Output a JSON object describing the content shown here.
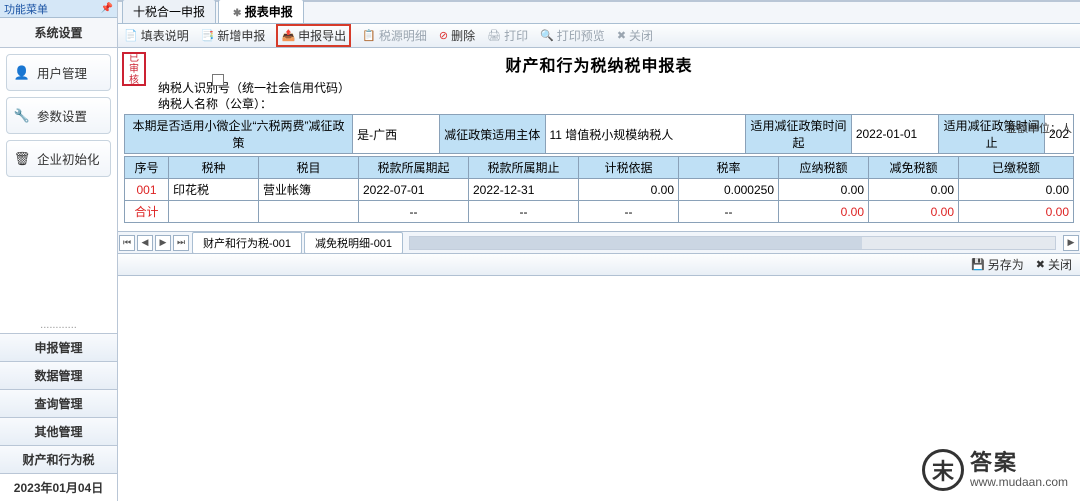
{
  "sidebar": {
    "title": "功能菜单",
    "group_label": "系统设置",
    "items": [
      {
        "label": "用户管理",
        "icon": "👤"
      },
      {
        "label": "参数设置",
        "icon": "🔧"
      },
      {
        "label": "企业初始化",
        "icon": "🗑"
      }
    ],
    "links": [
      "申报管理",
      "数据管理",
      "查询管理",
      "其他管理",
      "财产和行为税"
    ],
    "date": "2023年01月04日"
  },
  "tabs": [
    {
      "label": "十税合一申报"
    },
    {
      "label": "报表申报"
    }
  ],
  "toolbar": {
    "items": [
      {
        "label": "填表说明",
        "icon": "📄",
        "disabled": false,
        "hot": false
      },
      {
        "label": "新增申报",
        "icon": "📑",
        "disabled": false,
        "hot": false
      },
      {
        "label": "申报导出",
        "icon": "📤",
        "disabled": false,
        "hot": true
      },
      {
        "label": "税源明细",
        "icon": "📋",
        "disabled": true,
        "hot": false
      },
      {
        "label": "删除",
        "icon": "⊘",
        "disabled": false,
        "hot": false
      },
      {
        "label": "打印",
        "icon": "🖨",
        "disabled": true,
        "hot": false
      },
      {
        "label": "打印预览",
        "icon": "🔍",
        "disabled": true,
        "hot": false
      },
      {
        "label": "关闭",
        "icon": "✖",
        "disabled": true,
        "hot": false
      }
    ]
  },
  "form": {
    "stamp": "已审核",
    "title": "财产和行为税纳税申报表",
    "meta": {
      "taxpayer_id_label": "纳税人识别号（统一社会信用代码）",
      "taxpayer_id_value": "",
      "taxpayer_name_label": "纳税人名称（公章）：",
      "taxpayer_name_value": ""
    },
    "unit_label": "金额单位：人",
    "upper": {
      "policy_label": "本期是否适用小微企业“六税两费”减征政策",
      "policy_value": "是-广西",
      "subject_label": "减征政策适用主体",
      "subject_value": "11 增值税小规模纳税人",
      "start_label": "适用减征政策时间起",
      "start_value": "2022-01-01",
      "end_label": "适用减征政策时间止",
      "end_value": "202"
    },
    "columns": [
      "序号",
      "税种",
      "税目",
      "税款所属期起",
      "税款所属期止",
      "计税依据",
      "税率",
      "应纳税额",
      "减免税额",
      "已缴税额"
    ],
    "rows": [
      {
        "no": "001",
        "tax": "印花税",
        "item": "营业帐簿",
        "from": "2022-07-01",
        "to": "2022-12-31",
        "base": "0.00",
        "rate": "0.000250",
        "due": "0.00",
        "relief": "0.00",
        "paid": "0.00"
      }
    ],
    "total_label": "合计",
    "total": {
      "base": "--",
      "rate": "--",
      "due": "0.00",
      "relief": "0.00",
      "paid": "0.00"
    },
    "inner_tabs": [
      "财产和行为税-001",
      "减免税明细-001"
    ]
  },
  "sub_toolbar": {
    "save_as": "另存为",
    "close": "关闭"
  },
  "watermark": {
    "logo_char": "末",
    "cn": "答案",
    "url": "www.mudaan.com"
  }
}
